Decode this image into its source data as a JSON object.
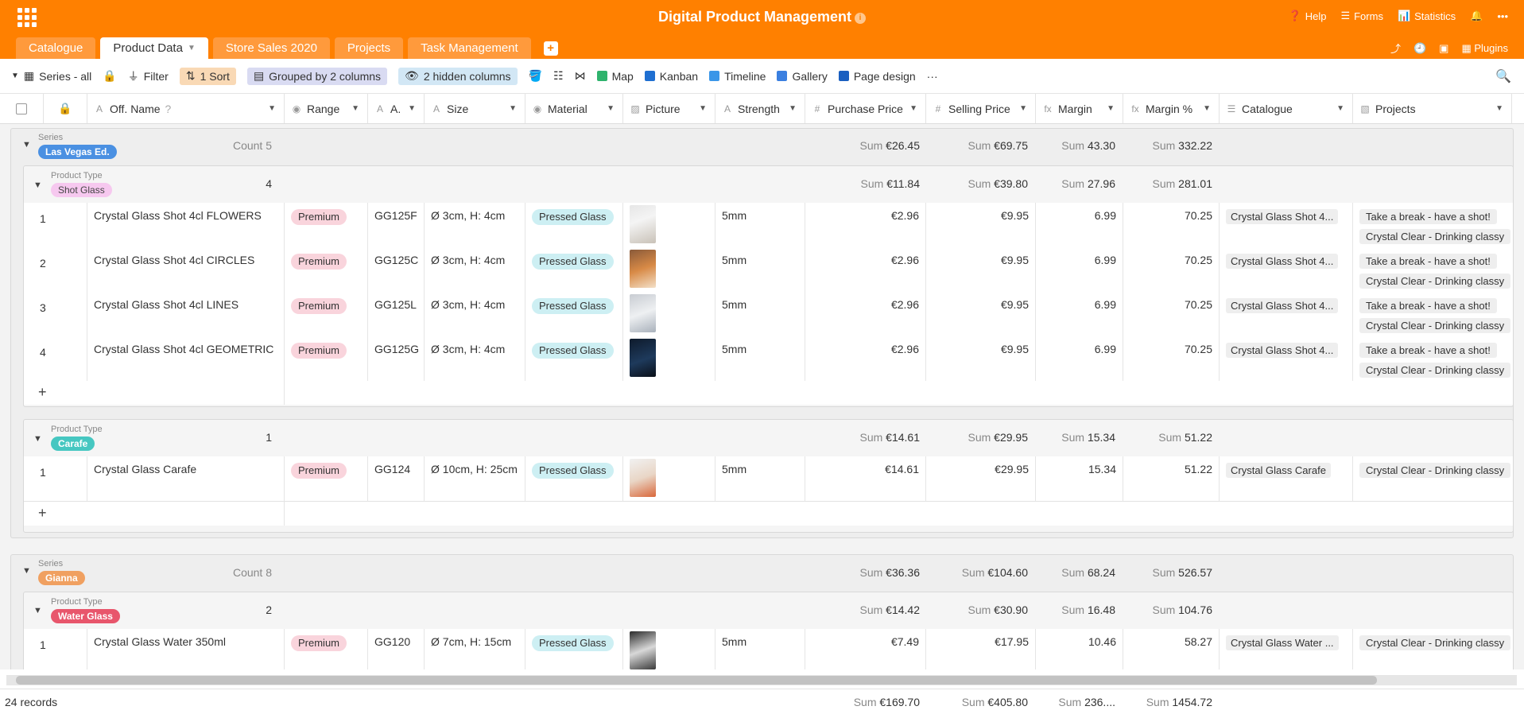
{
  "app": {
    "title": "Digital Product Management",
    "title_info_glyph": "i",
    "top_actions": [
      "Help",
      "Forms",
      "Statistics"
    ],
    "tabs": [
      {
        "label": "Catalogue"
      },
      {
        "label": "Product Data",
        "active": true
      },
      {
        "label": "Store Sales 2020"
      },
      {
        "label": "Projects"
      },
      {
        "label": "Task Management"
      }
    ],
    "add_tab_glyph": "+",
    "plugins_label": "Plugins",
    "brand_color": "#ff8000"
  },
  "toolbar": {
    "view": "Series - all",
    "filter": "Filter",
    "sort": "1 Sort",
    "grouped": "Grouped by 2 columns",
    "hidden": "2 hidden columns",
    "map": "Map",
    "kanban": "Kanban",
    "timeline": "Timeline",
    "gallery": "Gallery",
    "page_design": "Page design",
    "more": "···"
  },
  "columns": {
    "name": "Off. Name",
    "range": "Range",
    "a": "A.",
    "size": "Size",
    "material": "Material",
    "picture": "Picture",
    "strength": "Strength",
    "purchase": "Purchase Price",
    "selling": "Selling Price",
    "margin": "Margin",
    "margin_pct": "Margin %",
    "catalogue": "Catalogue",
    "projects": "Projects"
  },
  "groups": {
    "series_label": "Series",
    "product_type_label": "Product Type",
    "g1": {
      "name": "Las Vegas Ed.",
      "count": "Count 5",
      "sum_purchase": "€26.45",
      "sum_selling": "€69.75",
      "sum_margin": "43.30",
      "sum_margin_pct": "332.22",
      "sub1": {
        "name": "Shot Glass",
        "count": "4",
        "sum_purchase": "€11.84",
        "sum_selling": "€39.80",
        "sum_margin": "27.96",
        "sum_margin_pct": "281.01"
      },
      "sub2": {
        "name": "Carafe",
        "count": "1",
        "sum_purchase": "€14.61",
        "sum_selling": "€29.95",
        "sum_margin": "15.34",
        "sum_margin_pct": "51.22"
      }
    },
    "g2": {
      "name": "Gianna",
      "count": "Count 8",
      "sum_purchase": "€36.36",
      "sum_selling": "€104.60",
      "sum_margin": "68.24",
      "sum_margin_pct": "526.57",
      "sub1": {
        "name": "Water Glass",
        "count": "2",
        "sum_purchase": "€14.42",
        "sum_selling": "€30.90",
        "sum_margin": "16.48",
        "sum_margin_pct": "104.76"
      }
    },
    "sum_word": "Sum"
  },
  "rows": {
    "r1": {
      "n": "1",
      "name": "Crystal Glass Shot 4cl FLOWERS",
      "range": "Premium",
      "a": "GG125F",
      "size": "Ø 3cm, H: 4cm",
      "material": "Pressed Glass",
      "strength": "5mm",
      "purchase": "€2.96",
      "selling": "€9.95",
      "margin": "6.99",
      "margin_pct": "70.25",
      "catalogue": "Crystal Glass Shot 4...",
      "p1": "Take a break - have a shot!",
      "p2": "Crystal Clear - Drinking classy"
    },
    "r2": {
      "n": "2",
      "name": "Crystal Glass Shot 4cl CIRCLES",
      "range": "Premium",
      "a": "GG125C",
      "size": "Ø 3cm, H: 4cm",
      "material": "Pressed Glass",
      "strength": "5mm",
      "purchase": "€2.96",
      "selling": "€9.95",
      "margin": "6.99",
      "margin_pct": "70.25",
      "catalogue": "Crystal Glass Shot 4...",
      "p1": "Take a break - have a shot!",
      "p2": "Crystal Clear - Drinking classy"
    },
    "r3": {
      "n": "3",
      "name": "Crystal Glass Shot 4cl LINES",
      "range": "Premium",
      "a": "GG125L",
      "size": "Ø 3cm, H: 4cm",
      "material": "Pressed Glass",
      "strength": "5mm",
      "purchase": "€2.96",
      "selling": "€9.95",
      "margin": "6.99",
      "margin_pct": "70.25",
      "catalogue": "Crystal Glass Shot 4...",
      "p1": "Take a break - have a shot!",
      "p2": "Crystal Clear - Drinking classy"
    },
    "r4": {
      "n": "4",
      "name": "Crystal Glass Shot 4cl GEOMETRIC",
      "range": "Premium",
      "a": "GG125G",
      "size": "Ø 3cm, H: 4cm",
      "material": "Pressed Glass",
      "strength": "5mm",
      "purchase": "€2.96",
      "selling": "€9.95",
      "margin": "6.99",
      "margin_pct": "70.25",
      "catalogue": "Crystal Glass Shot 4...",
      "p1": "Take a break - have a shot!",
      "p2": "Crystal Clear - Drinking classy"
    },
    "r5": {
      "n": "1",
      "name": "Crystal Glass Carafe",
      "range": "Premium",
      "a": "GG124",
      "size": "Ø 10cm, H: 25cm",
      "material": "Pressed Glass",
      "strength": "5mm",
      "purchase": "€14.61",
      "selling": "€29.95",
      "margin": "15.34",
      "margin_pct": "51.22",
      "catalogue": "Crystal Glass Carafe",
      "p1": "Crystal Clear - Drinking classy"
    },
    "r6": {
      "n": "1",
      "name": "Crystal Glass Water 350ml",
      "range": "Premium",
      "a": "GG120",
      "size": "Ø 7cm, H: 15cm",
      "material": "Pressed Glass",
      "strength": "5mm",
      "purchase": "€7.49",
      "selling": "€17.95",
      "margin": "10.46",
      "margin_pct": "58.27",
      "catalogue": "Crystal Glass Water ...",
      "p1": "Crystal Clear - Drinking classy"
    }
  },
  "add_row_glyph": "+",
  "footer": {
    "records": "24 records",
    "sum_purchase": "€169.70",
    "sum_selling": "€405.80",
    "sum_margin": "236....",
    "sum_margin_pct": "1454.72"
  }
}
